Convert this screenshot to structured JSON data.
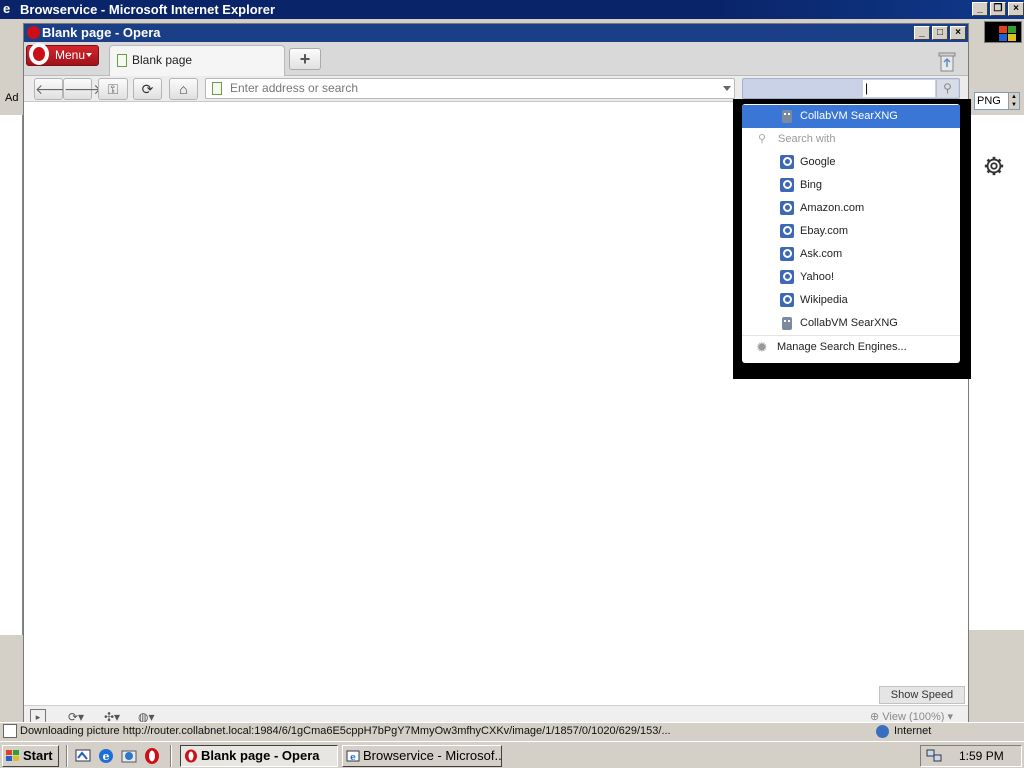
{
  "ie_window": {
    "title": "Browservice - Microsoft Internet Explorer",
    "address_label": "Ad",
    "format_select_value": "PNG",
    "status_text": "Downloading picture http://router.collabnet.local:1984/6/1gCma6E5cppH7bPgY7MmyOw3mfhyCXKv/image/1/1857/0/1020/629/153/...",
    "zone_label": "Internet"
  },
  "opera": {
    "title": "Blank page - Opera",
    "menu_label": "Menu",
    "tab_label": "Blank page",
    "new_tab_label": "+",
    "address_placeholder": "Enter address or search",
    "search_value": "",
    "show_speed_dial_label": "Show Speed Dial",
    "view_zoom_label": "View (100%)"
  },
  "search_popup": {
    "selected": "CollabVM SearXNG",
    "header": "Search with",
    "engines": [
      "Google",
      "Bing",
      "Amazon.com",
      "Ebay.com",
      "Ask.com",
      "Yahoo!",
      "Wikipedia",
      "CollabVM SearXNG"
    ],
    "manage_label": "Manage Search Engines..."
  },
  "taskbar": {
    "start_label": "Start",
    "tasks": [
      {
        "label": "Blank page - Opera",
        "active": true
      },
      {
        "label": "Browservice - Microsof...",
        "active": false
      }
    ],
    "clock": "1:59 PM"
  },
  "colors": {
    "ie_title_bg": "#0a246a",
    "opera_title_bg": "#1b3f86",
    "opera_menu_red": "#cc0f16",
    "selected_item_bg": "#3a76d6"
  }
}
